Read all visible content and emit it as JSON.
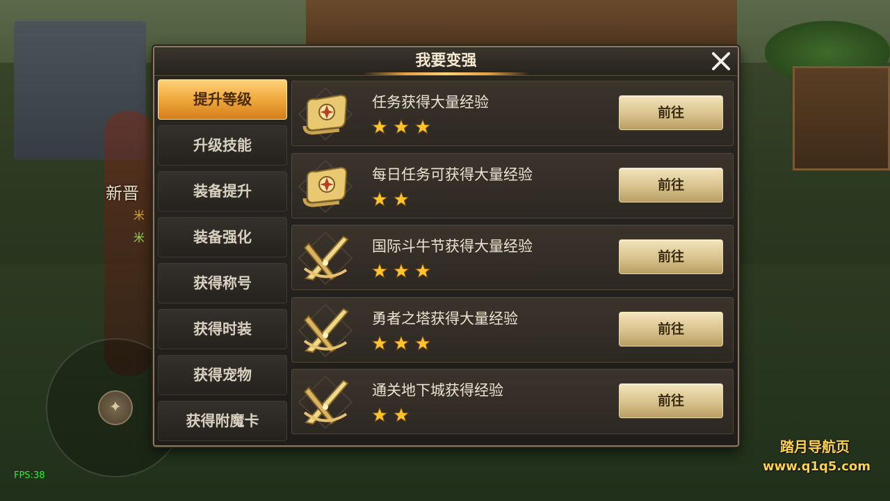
{
  "dialog": {
    "title": "我要变强"
  },
  "tabs": [
    {
      "label": "提升等级",
      "active": true
    },
    {
      "label": "升级技能",
      "active": false
    },
    {
      "label": "装备提升",
      "active": false
    },
    {
      "label": "装备强化",
      "active": false
    },
    {
      "label": "获得称号",
      "active": false
    },
    {
      "label": "获得时装",
      "active": false
    },
    {
      "label": "获得宠物",
      "active": false
    },
    {
      "label": "获得附魔卡",
      "active": false
    }
  ],
  "tasks": [
    {
      "text": "任务获得大量经验",
      "stars": 3,
      "button": "前往",
      "icon": "scroll-icon"
    },
    {
      "text": "每日任务可获得大量经验",
      "stars": 2,
      "button": "前往",
      "icon": "scroll-icon"
    },
    {
      "text": "国际斗牛节获得大量经验",
      "stars": 3,
      "button": "前往",
      "icon": "crossed-swords-icon"
    },
    {
      "text": "勇者之塔获得大量经验",
      "stars": 3,
      "button": "前往",
      "icon": "crossed-swords-icon"
    },
    {
      "text": "通关地下城获得经验",
      "stars": 2,
      "button": "前往",
      "icon": "crossed-swords-icon"
    }
  ],
  "hud": {
    "fps": "FPS:38",
    "npc_name": "新晋",
    "npc_sub1": "米",
    "npc_sub2": "米"
  },
  "watermark": {
    "line1": "踏月导航页",
    "line2": "www.q1q5.com"
  },
  "colors": {
    "tab_active": "#f0a83c",
    "star": "#ffc42e",
    "button": "#d8c28c",
    "fps": "#2cf02c",
    "watermark": "#ffd24a"
  }
}
